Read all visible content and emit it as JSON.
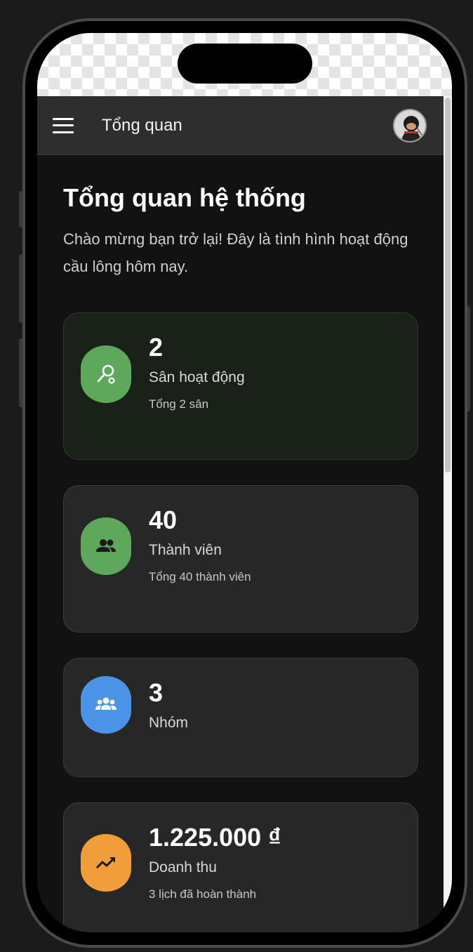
{
  "app_bar": {
    "title": "Tổng quan",
    "menu_icon": "hamburger-menu-icon",
    "avatar": "user-avatar"
  },
  "page": {
    "title": "Tổng quan hệ thống",
    "subtitle": "Chào mừng bạn trở lại! Đây là tình hình hoạt động cầu lông hôm nay."
  },
  "cards": [
    {
      "value": "2",
      "label": "Sân hoạt động",
      "note": "Tổng 2 sân",
      "icon": "badminton-racket-icon",
      "color": "#5da85a"
    },
    {
      "value": "40",
      "label": "Thành viên",
      "note": "Tổng 40 thành viên",
      "icon": "people-icon",
      "color": "#5da85a"
    },
    {
      "value": "3",
      "label": "Nhóm",
      "note": "",
      "icon": "groups-icon",
      "color": "#4a93e6"
    },
    {
      "value": "1.225.000 ₫",
      "label": "Doanh thu",
      "note": "3 lịch đã hoàn thành",
      "icon": "trending-up-icon",
      "color": "#f09d3a"
    }
  ]
}
